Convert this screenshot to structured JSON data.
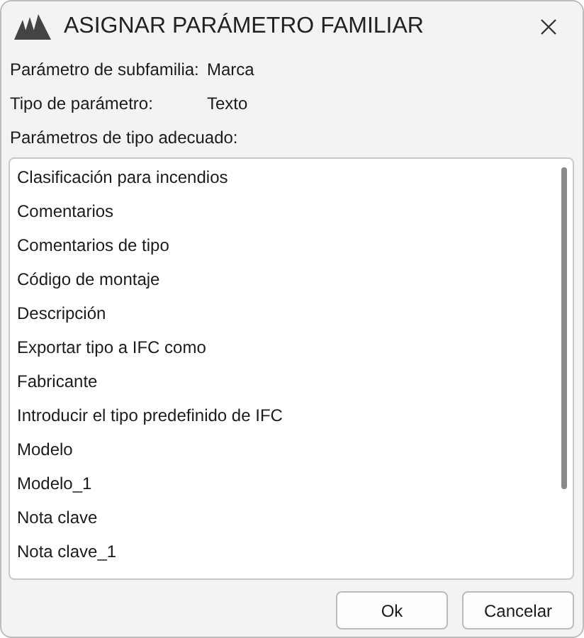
{
  "window": {
    "title": "ASIGNAR PARÁMETRO FAMILIAR"
  },
  "fields": [
    {
      "label": "Parámetro de subfamilia:",
      "value": "Marca"
    },
    {
      "label": "Tipo de parámetro:",
      "value": "Texto"
    }
  ],
  "list": {
    "label": "Parámetros de tipo adecuado:",
    "items": [
      {
        "text": "Clasificación para incendios",
        "selected": false
      },
      {
        "text": "Comentarios",
        "selected": false
      },
      {
        "text": "Comentarios de tipo",
        "selected": false
      },
      {
        "text": "Código de montaje",
        "selected": false
      },
      {
        "text": "Descripción",
        "selected": false
      },
      {
        "text": "Exportar tipo a IFC como",
        "selected": false
      },
      {
        "text": "Fabricante",
        "selected": false
      },
      {
        "text": "Introducir el tipo predefinido de IFC",
        "selected": false
      },
      {
        "text": "Modelo",
        "selected": false
      },
      {
        "text": "Modelo_1",
        "selected": false
      },
      {
        "text": "Nota clave",
        "selected": false
      },
      {
        "text": "Nota clave_1",
        "selected": false
      }
    ]
  },
  "buttons": [
    "Ok",
    "Cancelar"
  ]
}
